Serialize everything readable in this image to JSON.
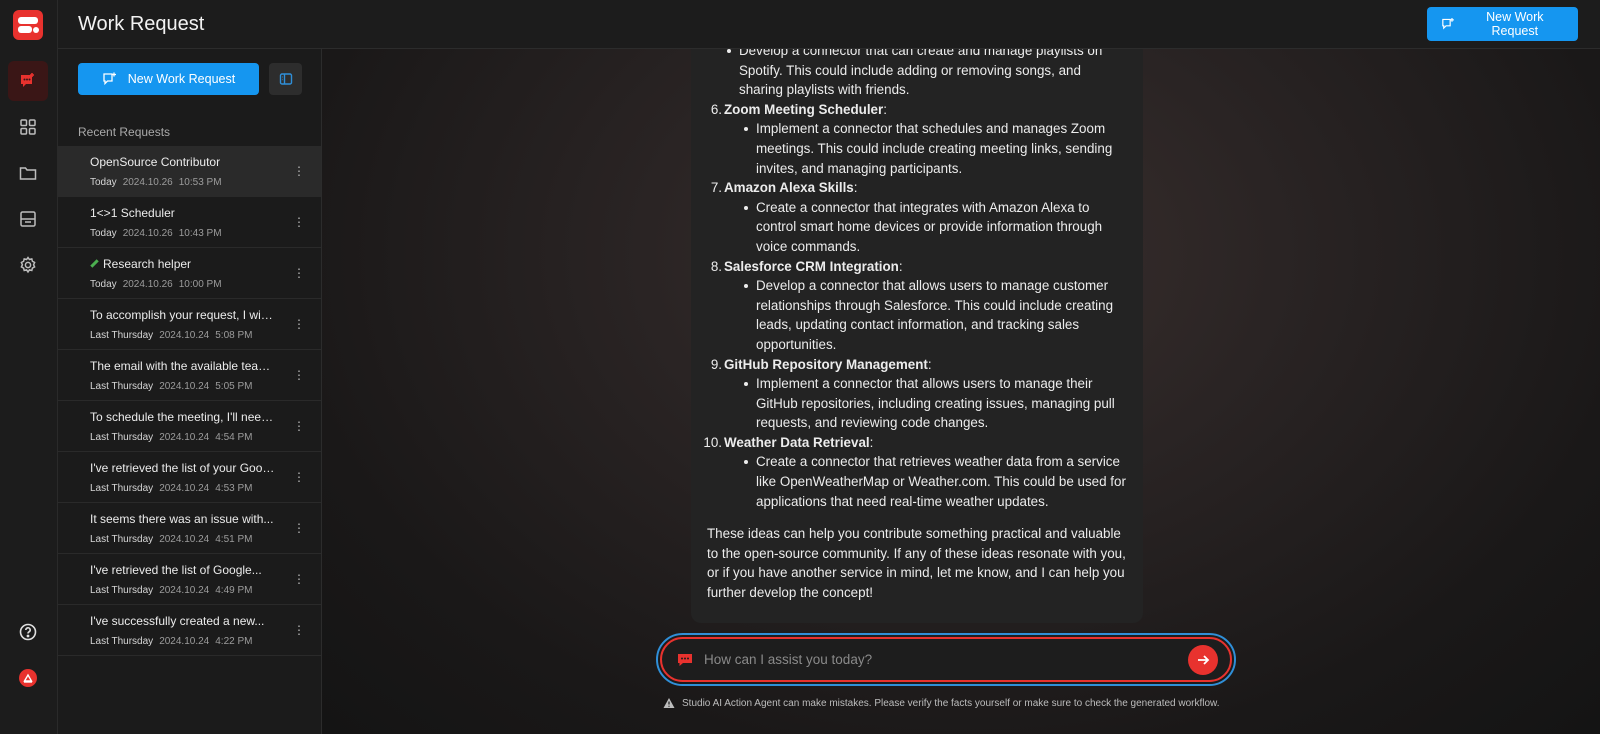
{
  "app": {
    "brand_color": "#e8322e",
    "accent_color": "#1596f0"
  },
  "header": {
    "title": "Work Request",
    "new_button": "New Work Request"
  },
  "rail": {
    "icons": [
      "work-request-icon",
      "dashboard-grid-icon",
      "folder-icon",
      "storefront-icon",
      "settings-gear-icon",
      "help-icon",
      "user-avatar-icon"
    ]
  },
  "sidebar": {
    "new_button": "New Work Request",
    "recent_label": "Recent Requests",
    "requests": [
      {
        "title": "OpenSource Contributor",
        "day": "Today",
        "date": "2024.10.26",
        "time": "10:53 PM"
      },
      {
        "title": "1<>1 Scheduler",
        "day": "Today",
        "date": "2024.10.26",
        "time": "10:43 PM"
      },
      {
        "title": "Research helper",
        "day": "Today",
        "date": "2024.10.26",
        "time": "10:00 PM"
      },
      {
        "title": "To accomplish your request, I will...",
        "day": "Last Thursday",
        "date": "2024.10.24",
        "time": "5:08 PM"
      },
      {
        "title": "The email with the available team...",
        "day": "Last Thursday",
        "date": "2024.10.24",
        "time": "5:05 PM"
      },
      {
        "title": "To schedule the meeting, I'll need ...",
        "day": "Last Thursday",
        "date": "2024.10.24",
        "time": "4:54 PM"
      },
      {
        "title": "I've retrieved the list of your Googl...",
        "day": "Last Thursday",
        "date": "2024.10.24",
        "time": "4:53 PM"
      },
      {
        "title": "It seems there was an issue with...",
        "day": "Last Thursday",
        "date": "2024.10.24",
        "time": "4:51 PM"
      },
      {
        "title": "I've retrieved the list of Google...",
        "day": "Last Thursday",
        "date": "2024.10.24",
        "time": "4:49 PM"
      },
      {
        "title": "I've successfully created a new...",
        "day": "Last Thursday",
        "date": "2024.10.24",
        "time": "4:22 PM"
      }
    ]
  },
  "message": {
    "top_bullet": "Develop a connector that can create and manage playlists on Spotify. This could include adding or removing songs, and sharing playlists with friends.",
    "items": [
      {
        "num": "6.",
        "title": "Zoom Meeting Scheduler",
        "desc": "Implement a connector that schedules and manages Zoom meetings. This could include creating meeting links, sending invites, and managing participants."
      },
      {
        "num": "7.",
        "title": "Amazon Alexa Skills",
        "desc": "Create a connector that integrates with Amazon Alexa to control smart home devices or provide information through voice commands."
      },
      {
        "num": "8.",
        "title": "Salesforce CRM Integration",
        "desc": "Develop a connector that allows users to manage customer relationships through Salesforce. This could include creating leads, updating contact information, and tracking sales opportunities."
      },
      {
        "num": "9.",
        "title": "GitHub Repository Management",
        "desc": "Implement a connector that allows users to manage their GitHub repositories, including creating issues, managing pull requests, and reviewing code changes."
      },
      {
        "num": "10.",
        "title": "Weather Data Retrieval",
        "desc": "Create a connector that retrieves weather data from a service like OpenWeatherMap or Weather.com. This could be used for applications that need real-time weather updates."
      }
    ],
    "closing": "These ideas can help you contribute something practical and valuable to the open-source community. If any of these ideas resonate with you, or if you have another service in mind, let me know, and I can help you further develop the concept!"
  },
  "composer": {
    "placeholder": "How can I assist you today?",
    "value": ""
  },
  "disclaimer": "Studio AI Action Agent can make mistakes. Please verify the facts yourself or make sure to check the generated workflow."
}
